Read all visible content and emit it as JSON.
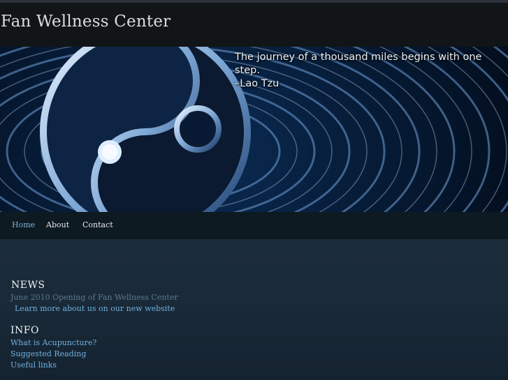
{
  "header": {
    "site_title": "Fan Wellness Center"
  },
  "banner": {
    "quote_line1": "The journey of a thousand miles begins with one step.",
    "quote_line2": "–Lao Tzu",
    "image_icon": "yin-yang-icon"
  },
  "nav": {
    "items": [
      {
        "label": "Home",
        "active": true
      },
      {
        "label": "About",
        "active": false
      },
      {
        "label": "Contact",
        "active": false
      }
    ]
  },
  "news": {
    "heading": "NEWS",
    "date_text": "June 2010 Opening of Fan Wellness Center",
    "link_text": "Learn more about us on our new website"
  },
  "info": {
    "heading": "INFO",
    "links": [
      "What is Acupuncture?",
      "Suggested Reading",
      "Useful links"
    ]
  },
  "colors": {
    "background": "#142230",
    "header": "#111518",
    "nav": "#0e1a22",
    "link": "#6fb0e0",
    "active_nav": "#7fb2d9",
    "muted_text": "#5d7891"
  }
}
